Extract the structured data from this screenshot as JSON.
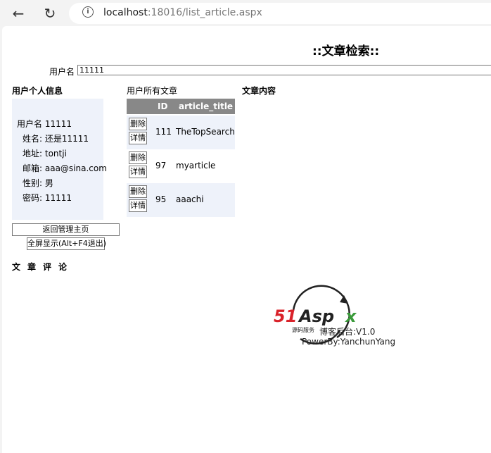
{
  "browser": {
    "url_host": "localhost",
    "url_rest": ":18016/list_article.aspx"
  },
  "page": {
    "title": "::文章检索::",
    "username_label": "用户名",
    "username_value": "11111"
  },
  "sections": {
    "user_info": "用户个人信息",
    "user_articles": "用户所有文章",
    "article_content": "文章内容",
    "comments": "文章评论"
  },
  "user_info": {
    "rows": [
      {
        "label": "用户名",
        "value": "11111"
      },
      {
        "label": "姓名:",
        "value": "还是11111"
      },
      {
        "label": "地址:",
        "value": "tontji"
      },
      {
        "label": "邮箱:",
        "value": "aaa@sina.com"
      },
      {
        "label": "性别:",
        "value": "男"
      },
      {
        "label": "密码:",
        "value": "11111"
      }
    ]
  },
  "buttons": {
    "back_home": "返回管理主页",
    "fullscreen": "全屏显示(Alt+F4退出)"
  },
  "table": {
    "headers": [
      "",
      "ID",
      "article_title"
    ],
    "delete_label": "删除",
    "detail_label": "详情",
    "rows": [
      {
        "id": "111",
        "title": "TheTopSearch"
      },
      {
        "id": "97",
        "title": "myarticle"
      },
      {
        "id": "95",
        "title": "aaachi"
      }
    ]
  },
  "logo": {
    "text": "51Aspx",
    "sub": "源码服务"
  },
  "footer": {
    "line1": "博客后台:V1.0",
    "line2": "PowerBy:YanchunYang"
  },
  "colors": {
    "header_gray": "#888888",
    "alt_row": "#eef2fa",
    "logo_red": "#d9222a",
    "logo_green": "#3a9a3a"
  }
}
